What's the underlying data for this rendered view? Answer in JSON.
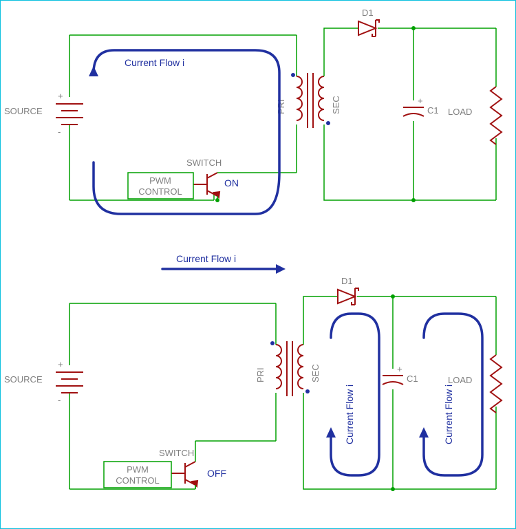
{
  "top": {
    "source": "SOURCE",
    "source_plus": "+",
    "source_minus": "-",
    "pwm": "PWM\nCONTROL",
    "switch": "SWITCH",
    "state": "ON",
    "pri": "PRI",
    "sec": "SEC",
    "d1": "D1",
    "c1": "C1",
    "c1_plus": "+",
    "load": "LOAD",
    "flow": "Current Flow i"
  },
  "bot": {
    "source": "SOURCE",
    "source_plus": "+",
    "source_minus": "-",
    "pwm": "PWM\nCONTROL",
    "switch": "SWITCH",
    "state": "OFF",
    "pri": "PRI",
    "sec": "SEC",
    "d1": "D1",
    "c1": "C1",
    "c1_plus": "+",
    "load": "LOAD",
    "flow_top": "Current Flow i",
    "flow_left": "Current Flow i",
    "flow_right": "Current Flow i"
  }
}
